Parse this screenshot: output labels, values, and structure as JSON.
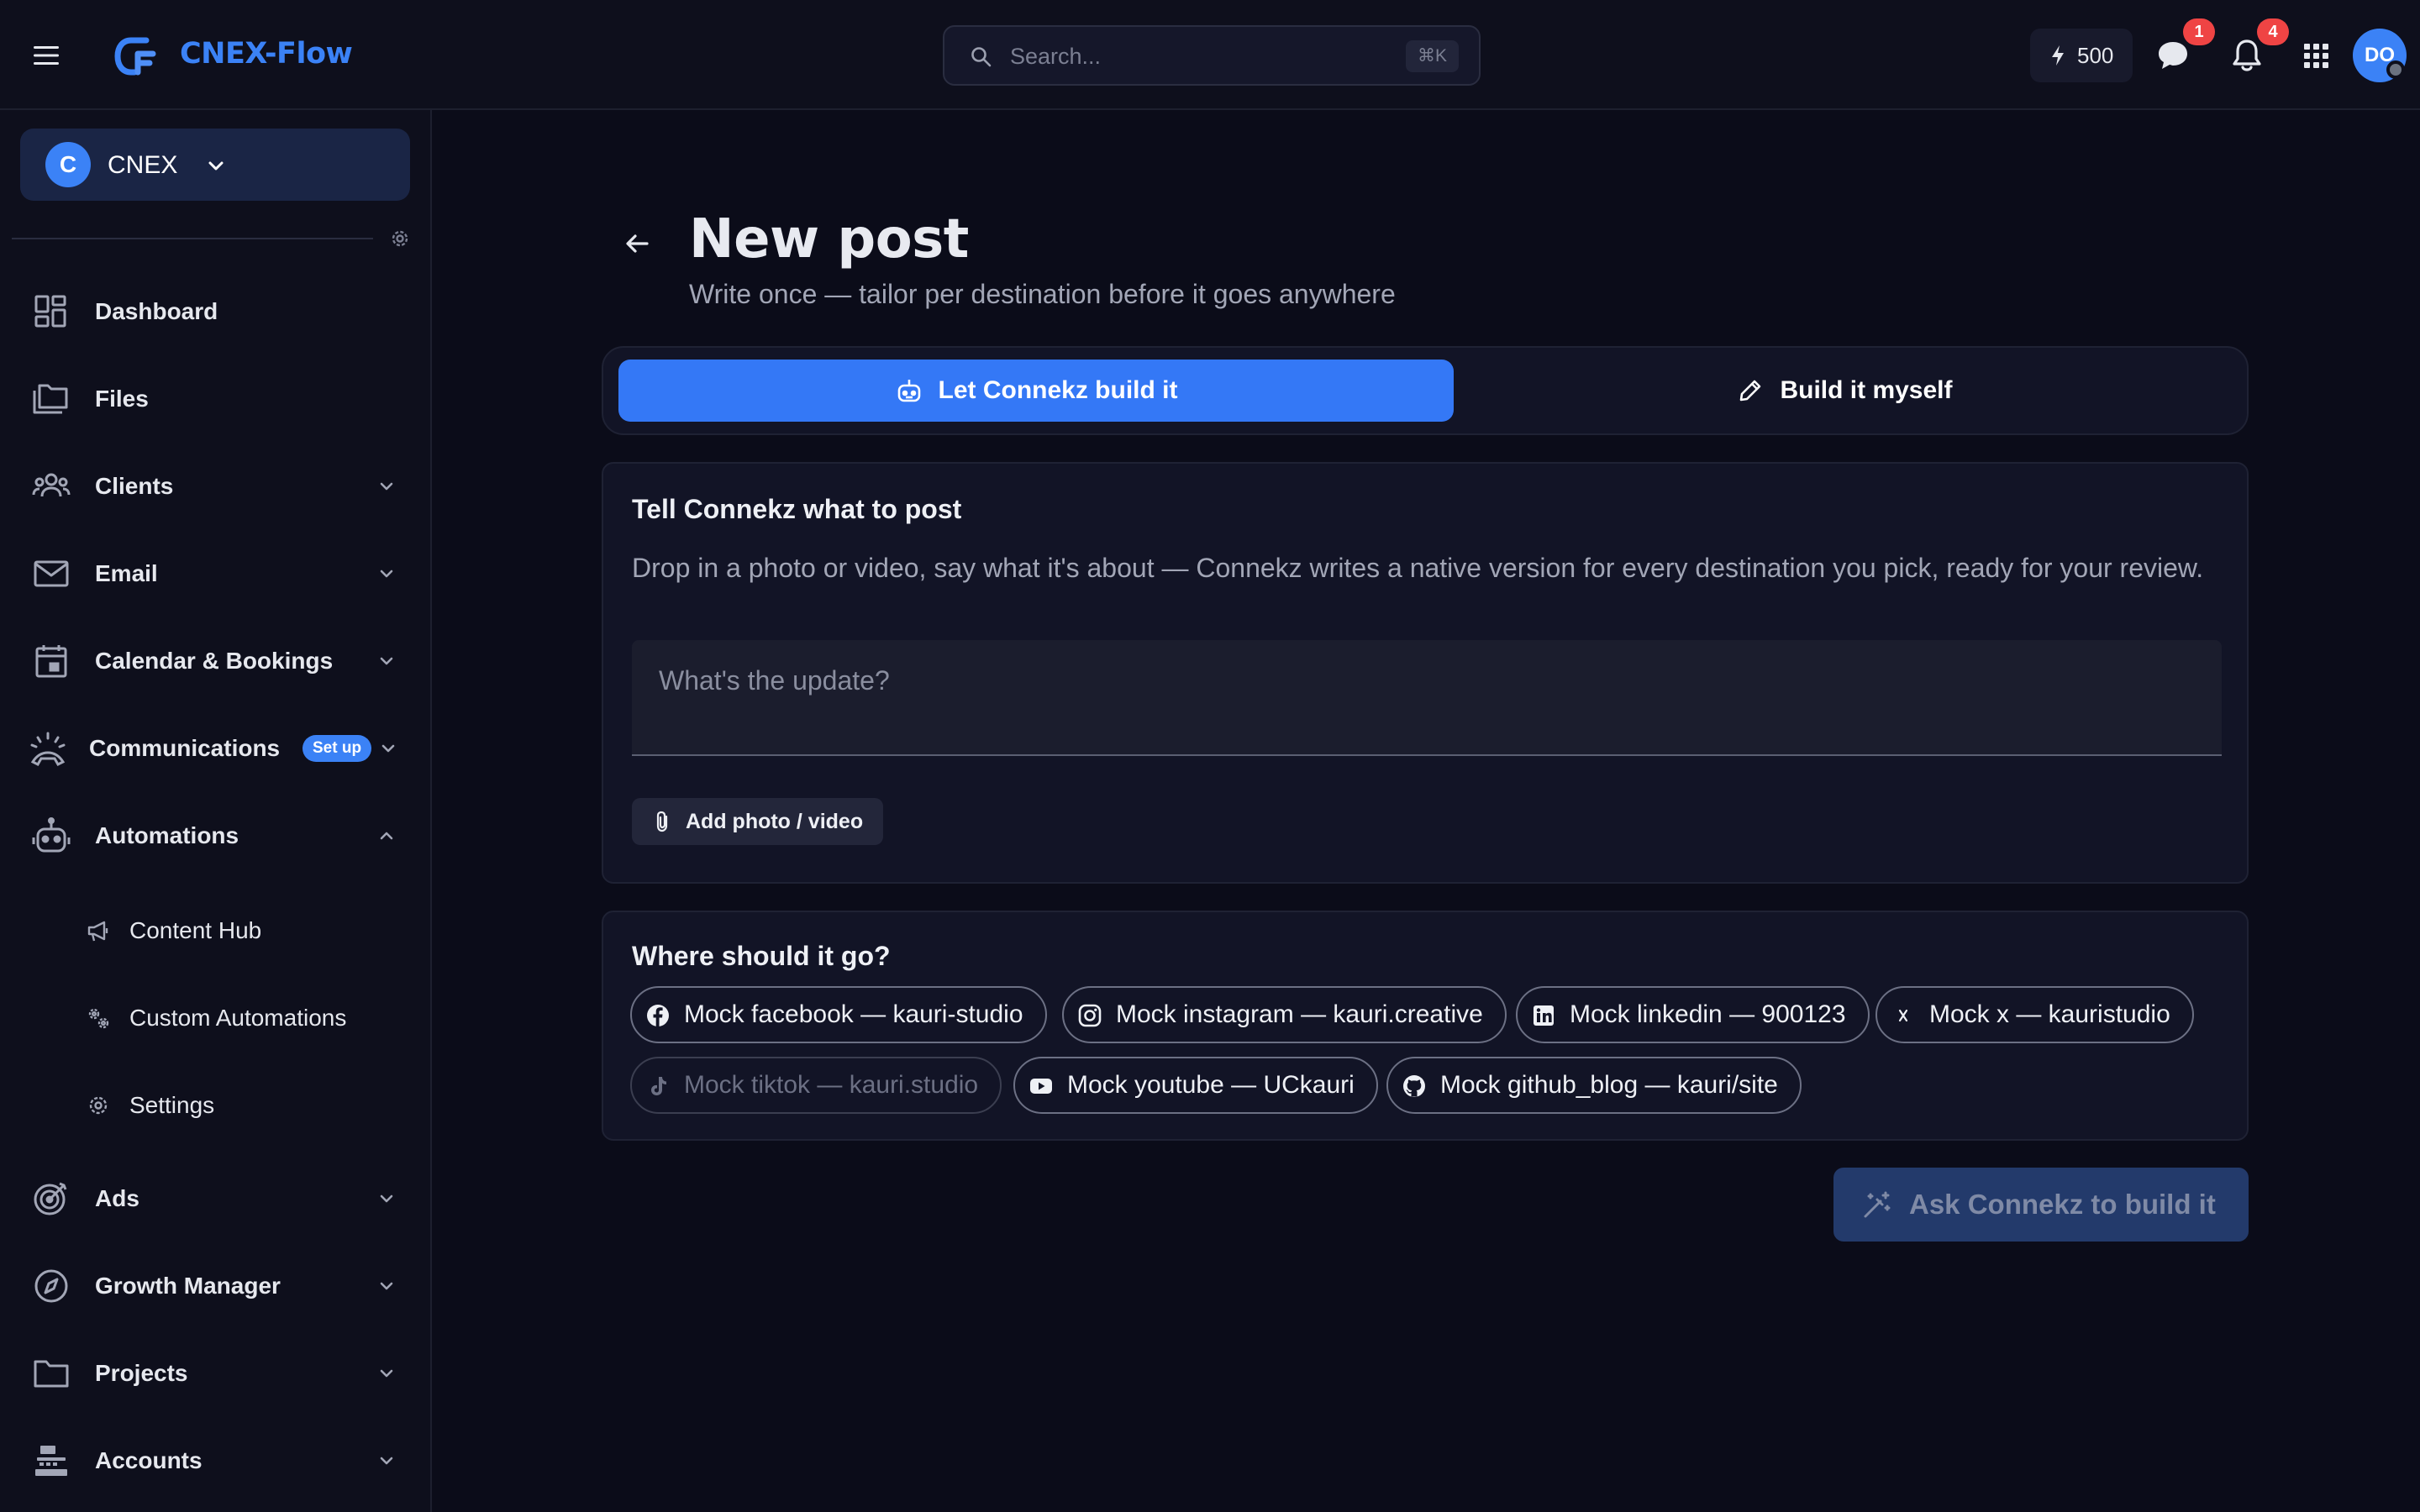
{
  "app": {
    "name": "CNEX-Flow",
    "brand_color": "#3b82f6",
    "accent_color": "#3478f6"
  },
  "topbar": {
    "search_placeholder": "Search...",
    "search_shortcut": "⌘K",
    "credits": "500",
    "messages_badge": "1",
    "notifications_badge": "4",
    "avatar_initials": "DO",
    "icons": [
      "menu-icon",
      "search-icon",
      "bolt-icon",
      "chat-icon",
      "bell-icon",
      "apps-grid-icon"
    ]
  },
  "sidebar": {
    "workspace": {
      "initial": "C",
      "name": "CNEX"
    },
    "items": [
      {
        "label": "Dashboard",
        "icon": "dashboard-icon"
      },
      {
        "label": "Files",
        "icon": "files-icon"
      },
      {
        "label": "Clients",
        "icon": "users-icon"
      },
      {
        "label": "Email",
        "icon": "mail-icon"
      },
      {
        "label": "Calendar & Bookings",
        "icon": "calendar-icon"
      },
      {
        "label": "Communications",
        "icon": "phone-icon",
        "badge": "Set up"
      },
      {
        "label": "Automations",
        "icon": "robot-icon"
      },
      {
        "label": "Content Hub",
        "icon": "megaphone-icon"
      },
      {
        "label": "Custom Automations",
        "icon": "gears-icon"
      },
      {
        "label": "Settings",
        "icon": "gear-icon"
      },
      {
        "label": "Ads",
        "icon": "target-icon"
      },
      {
        "label": "Growth Manager",
        "icon": "compass-icon"
      },
      {
        "label": "Projects",
        "icon": "folder-icon"
      },
      {
        "label": "Accounts",
        "icon": "register-icon"
      }
    ]
  },
  "main": {
    "title": "New post",
    "subtitle": "Write once — tailor per destination before it goes anywhere",
    "mode_auto": "Let Connekz build it",
    "mode_manual": "Build it myself",
    "compose_card": {
      "title": "Tell Connekz what to post",
      "description": "Drop in a photo or video, say what it's about — Connekz writes a native version for every destination you pick, ready for your review.",
      "placeholder": "What's the update?",
      "attach_label": "Add photo / video"
    },
    "destinations_card": {
      "title": "Where should it go?",
      "chips": [
        {
          "label": "Mock facebook — kauri-studio",
          "icon": "facebook-icon",
          "enabled": true
        },
        {
          "label": "Mock instagram — kauri.creative",
          "icon": "instagram-icon",
          "enabled": true
        },
        {
          "label": "Mock linkedin — 900123",
          "icon": "linkedin-icon",
          "enabled": true
        },
        {
          "label": "Mock x — kauristudio",
          "icon": "x-icon",
          "enabled": true
        },
        {
          "label": "Mock tiktok — kauri.studio",
          "icon": "tiktok-icon",
          "enabled": false
        },
        {
          "label": "Mock youtube — UCkauri",
          "icon": "youtube-icon",
          "enabled": true
        },
        {
          "label": "Mock github_blog — kauri/site",
          "icon": "github-icon",
          "enabled": true
        }
      ]
    },
    "submit_label": "Ask Connekz to build it"
  }
}
